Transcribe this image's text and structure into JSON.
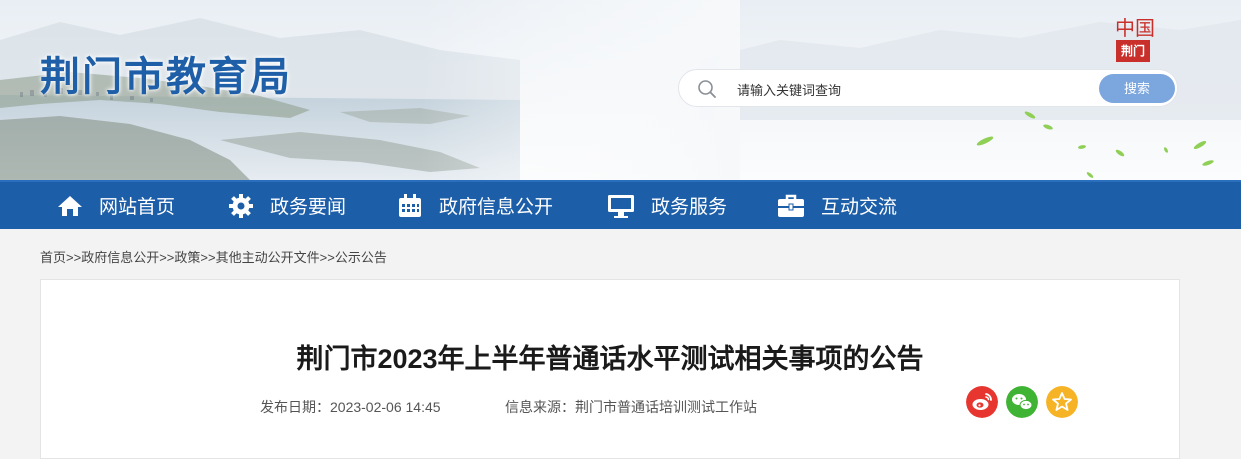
{
  "header": {
    "site_title": "荆门市教育局",
    "logo": {
      "top_text": "中国",
      "box_text": "荆门"
    },
    "search": {
      "placeholder": "请输入关键词查询",
      "icon": "search-icon",
      "button_label": "搜索"
    }
  },
  "nav": {
    "items": [
      {
        "label": "网站首页",
        "icon": "home-icon"
      },
      {
        "label": "政务要闻",
        "icon": "gear-icon"
      },
      {
        "label": "政府信息公开",
        "icon": "calendar-icon"
      },
      {
        "label": "政务服务",
        "icon": "monitor-icon"
      },
      {
        "label": "互动交流",
        "icon": "briefcase-icon"
      }
    ]
  },
  "breadcrumb": [
    "首页",
    "政府信息公开",
    "政策",
    "其他主动公开文件",
    "公示公告"
  ],
  "breadcrumb_sep": ">>",
  "article": {
    "title": "荆门市2023年上半年普通话水平测试相关事项的公告",
    "publish_label": "发布日期：",
    "publish_date": "2023-02-06 14:45",
    "source_label": "信息来源：",
    "source": "荆门市普通话培训测试工作站"
  },
  "share": [
    {
      "icon": "weibo-icon",
      "color": "#e6362f"
    },
    {
      "icon": "wechat-icon",
      "color": "#3fb434"
    },
    {
      "icon": "star-icon",
      "color": "#f5b325"
    }
  ],
  "colors": {
    "nav_bg": "#1d5ea8",
    "title_blue": "#1f5fa8",
    "search_button": "#7ba6de"
  }
}
